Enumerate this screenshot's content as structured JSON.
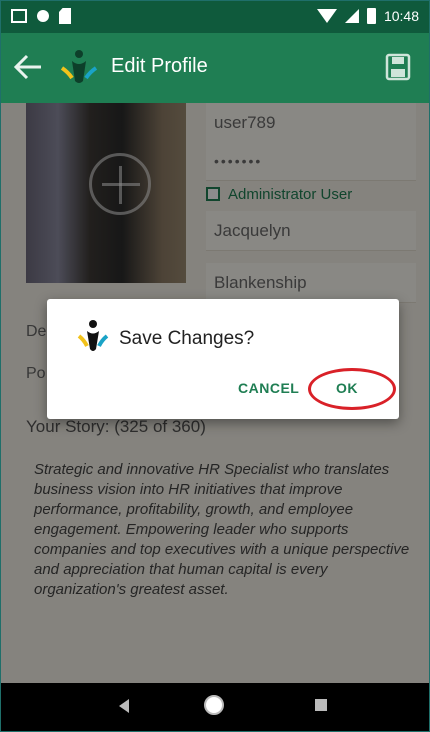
{
  "status_bar": {
    "time": "10:48",
    "icons": [
      "gmail-icon",
      "circle-icon",
      "sd-card-icon",
      "wifi-icon",
      "signal-icon",
      "battery-icon"
    ]
  },
  "app_bar": {
    "title": "Edit Profile",
    "icons": [
      "back-arrow-icon",
      "app-logo-icon",
      "save-icon"
    ]
  },
  "form": {
    "username": "user789",
    "password": "•••••••",
    "admin_label": "Administrator User",
    "admin_checked": false,
    "first_name": "Jacquelyn",
    "last_name": "Blankenship",
    "department_label": "De",
    "position_label": "Po",
    "story_label": "Your Story:  (325 of 360)",
    "story_text": "Strategic and innovative HR Specialist who translates business vision into HR initiatives that improve performance, profitability, growth, and employee engagement. Empowering leader who supports companies and top executives with a unique perspective and appreciation that human capital is every organization's greatest asset."
  },
  "dialog": {
    "title": "Save Changes?",
    "cancel_label": "CANCEL",
    "ok_label": "OK"
  },
  "colors": {
    "primary": "#1f7e53",
    "status_bar": "#0f5a3c",
    "highlight_ring": "#d92128"
  }
}
